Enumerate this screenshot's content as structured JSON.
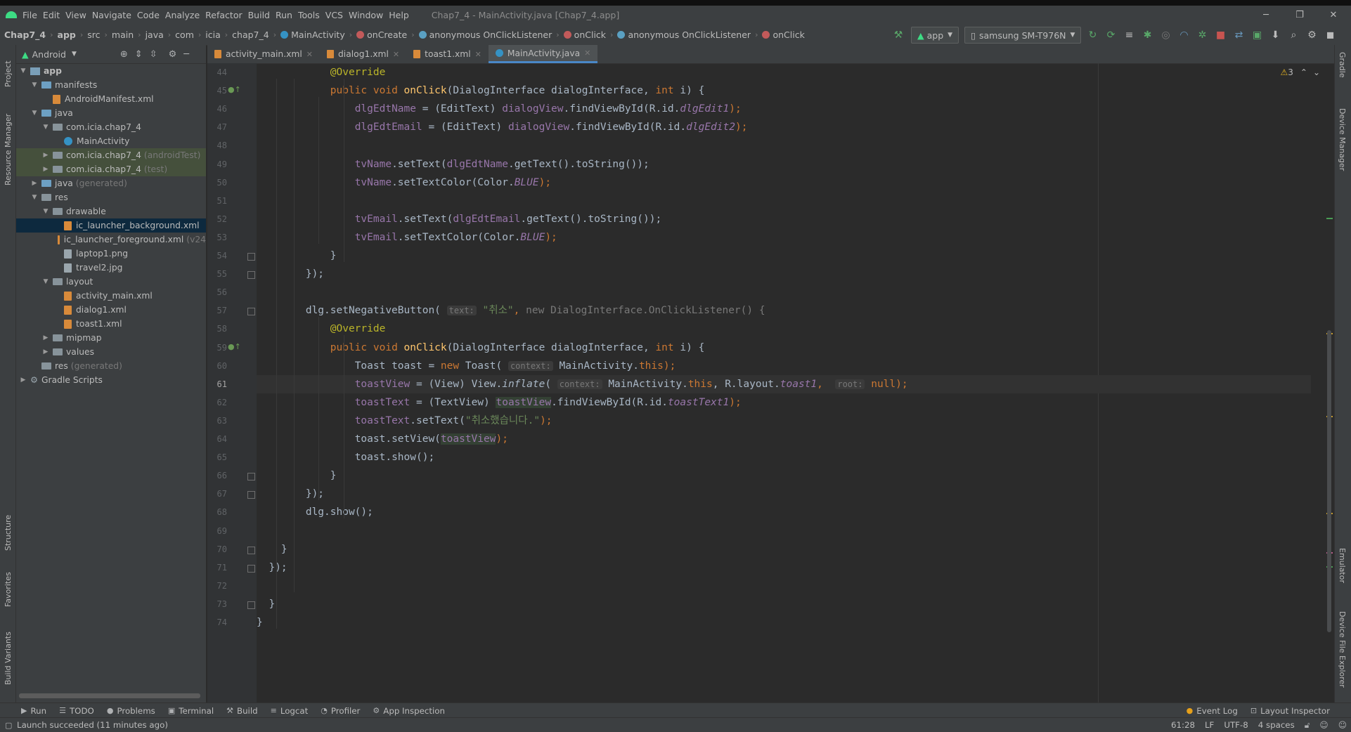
{
  "window": {
    "title": "Chap7_4 - MainActivity.java [Chap7_4.app]",
    "minimize": "─",
    "restore": "❐",
    "close": "✕"
  },
  "menu": [
    "File",
    "Edit",
    "View",
    "Navigate",
    "Code",
    "Analyze",
    "Refactor",
    "Build",
    "Run",
    "Tools",
    "VCS",
    "Window",
    "Help"
  ],
  "breadcrumb": [
    {
      "label": "Chap7_4",
      "icon": ""
    },
    {
      "label": "app",
      "icon": ""
    },
    {
      "label": "src",
      "icon": ""
    },
    {
      "label": "main",
      "icon": ""
    },
    {
      "label": "java",
      "icon": ""
    },
    {
      "label": "com",
      "icon": ""
    },
    {
      "label": "icia",
      "icon": ""
    },
    {
      "label": "chap7_4",
      "icon": ""
    },
    {
      "label": "MainActivity",
      "icon": "class-icon"
    },
    {
      "label": "onCreate",
      "icon": "method-icon"
    },
    {
      "label": "anonymous OnClickListener",
      "icon": "anonymous-class-icon"
    },
    {
      "label": "onClick",
      "icon": "method-icon"
    },
    {
      "label": "anonymous OnClickListener",
      "icon": "anonymous-class-icon"
    },
    {
      "label": "onClick",
      "icon": "method-icon"
    }
  ],
  "toolbar": {
    "run_config": "app",
    "device": "samsung SM-T976N"
  },
  "project_panel": {
    "view_selector": "Android",
    "tree": [
      {
        "label": "app",
        "suffix": "",
        "depth": 0,
        "arrow": "▼",
        "icon": "module",
        "bold": true
      },
      {
        "label": "manifests",
        "suffix": "",
        "depth": 1,
        "arrow": "▼",
        "icon": "folder-blue"
      },
      {
        "label": "AndroidManifest.xml",
        "suffix": "",
        "depth": 2,
        "arrow": "",
        "icon": "xml"
      },
      {
        "label": "java",
        "suffix": "",
        "depth": 1,
        "arrow": "▼",
        "icon": "folder-blue"
      },
      {
        "label": "com.icia.chap7_4",
        "suffix": "",
        "depth": 2,
        "arrow": "▼",
        "icon": "folder"
      },
      {
        "label": "MainActivity",
        "suffix": "",
        "depth": 3,
        "arrow": "",
        "icon": "class"
      },
      {
        "label": "com.icia.chap7_4",
        "suffix": "(androidTest)",
        "depth": 2,
        "arrow": "▶",
        "icon": "folder",
        "hl": true
      },
      {
        "label": "com.icia.chap7_4",
        "suffix": "(test)",
        "depth": 2,
        "arrow": "▶",
        "icon": "folder",
        "hl": true
      },
      {
        "label": "java",
        "suffix": "(generated)",
        "depth": 1,
        "arrow": "▶",
        "icon": "folder-blue"
      },
      {
        "label": "res",
        "suffix": "",
        "depth": 1,
        "arrow": "▼",
        "icon": "folder"
      },
      {
        "label": "drawable",
        "suffix": "",
        "depth": 2,
        "arrow": "▼",
        "icon": "folder"
      },
      {
        "label": "ic_launcher_background.xml",
        "suffix": "",
        "depth": 3,
        "arrow": "",
        "icon": "xml",
        "selected": true
      },
      {
        "label": "ic_launcher_foreground.xml",
        "suffix": "(v24",
        "depth": 3,
        "arrow": "",
        "icon": "xml"
      },
      {
        "label": "laptop1.png",
        "suffix": "",
        "depth": 3,
        "arrow": "",
        "icon": "img"
      },
      {
        "label": "travel2.jpg",
        "suffix": "",
        "depth": 3,
        "arrow": "",
        "icon": "img"
      },
      {
        "label": "layout",
        "suffix": "",
        "depth": 2,
        "arrow": "▼",
        "icon": "folder"
      },
      {
        "label": "activity_main.xml",
        "suffix": "",
        "depth": 3,
        "arrow": "",
        "icon": "xml"
      },
      {
        "label": "dialog1.xml",
        "suffix": "",
        "depth": 3,
        "arrow": "",
        "icon": "xml"
      },
      {
        "label": "toast1.xml",
        "suffix": "",
        "depth": 3,
        "arrow": "",
        "icon": "xml"
      },
      {
        "label": "mipmap",
        "suffix": "",
        "depth": 2,
        "arrow": "▶",
        "icon": "folder"
      },
      {
        "label": "values",
        "suffix": "",
        "depth": 2,
        "arrow": "▶",
        "icon": "folder"
      },
      {
        "label": "res",
        "suffix": "(generated)",
        "depth": 1,
        "arrow": "",
        "icon": "folder"
      },
      {
        "label": "Gradle Scripts",
        "suffix": "",
        "depth": 0,
        "arrow": "▶",
        "icon": "gradle"
      }
    ]
  },
  "editor_tabs": [
    {
      "label": "activity_main.xml",
      "active": false
    },
    {
      "label": "dialog1.xml",
      "active": false
    },
    {
      "label": "toast1.xml",
      "active": false
    },
    {
      "label": "MainActivity.java",
      "active": true
    }
  ],
  "inspection": {
    "warnings": "3"
  },
  "code_lines": [
    {
      "n": "44",
      "ind": "            ",
      "seg": [
        {
          "t": "@Override",
          "c": "an"
        }
      ]
    },
    {
      "n": "45",
      "ind": "            ",
      "mark": true,
      "seg": [
        {
          "t": "public void ",
          "c": "kw"
        },
        {
          "t": "onClick",
          "c": "fn"
        },
        {
          "t": "(DialogInterface dialogInterface, ",
          "c": ""
        },
        {
          "t": "int ",
          "c": "kw"
        },
        {
          "t": "i) {",
          "c": ""
        }
      ]
    },
    {
      "n": "46",
      "ind": "                ",
      "seg": [
        {
          "t": "dlgEdtName",
          "c": "fd"
        },
        {
          "t": " = (EditText) ",
          "c": ""
        },
        {
          "t": "dialogView",
          "c": "fd"
        },
        {
          "t": ".findViewById(R.id.",
          "c": ""
        },
        {
          "t": "dlgEdit1",
          "c": "fd it"
        },
        {
          "t": ");",
          "c": "kw"
        }
      ]
    },
    {
      "n": "47",
      "ind": "                ",
      "seg": [
        {
          "t": "dlgEdtEmail",
          "c": "fd"
        },
        {
          "t": " = (EditText) ",
          "c": ""
        },
        {
          "t": "dialogView",
          "c": "fd"
        },
        {
          "t": ".findViewById(R.id.",
          "c": ""
        },
        {
          "t": "dlgEdit2",
          "c": "fd it"
        },
        {
          "t": ");",
          "c": "kw"
        }
      ]
    },
    {
      "n": "48",
      "ind": "",
      "seg": []
    },
    {
      "n": "49",
      "ind": "                ",
      "seg": [
        {
          "t": "tvName",
          "c": "fd"
        },
        {
          "t": ".setText(",
          "c": ""
        },
        {
          "t": "dlgEdtName",
          "c": "fd"
        },
        {
          "t": ".getText().toString());",
          "c": ""
        }
      ]
    },
    {
      "n": "50",
      "ind": "                ",
      "seg": [
        {
          "t": "tvName",
          "c": "fd"
        },
        {
          "t": ".setTextColor(Color.",
          "c": ""
        },
        {
          "t": "BLUE",
          "c": "fd it"
        },
        {
          "t": ");",
          "c": "kw"
        }
      ]
    },
    {
      "n": "51",
      "ind": "",
      "seg": []
    },
    {
      "n": "52",
      "ind": "                ",
      "seg": [
        {
          "t": "tvEmail",
          "c": "fd"
        },
        {
          "t": ".setText(",
          "c": ""
        },
        {
          "t": "dlgEdtEmail",
          "c": "fd"
        },
        {
          "t": ".getText().toString());",
          "c": ""
        }
      ]
    },
    {
      "n": "53",
      "ind": "                ",
      "seg": [
        {
          "t": "tvEmail",
          "c": "fd"
        },
        {
          "t": ".setTextColor(Color.",
          "c": ""
        },
        {
          "t": "BLUE",
          "c": "fd it"
        },
        {
          "t": ");",
          "c": "kw"
        }
      ]
    },
    {
      "n": "54",
      "ind": "            ",
      "fold": true,
      "seg": [
        {
          "t": "}",
          "c": ""
        }
      ]
    },
    {
      "n": "55",
      "ind": "        ",
      "fold": true,
      "seg": [
        {
          "t": "});",
          "c": ""
        }
      ]
    },
    {
      "n": "56",
      "ind": "",
      "seg": []
    },
    {
      "n": "57",
      "ind": "        ",
      "fold": true,
      "seg": [
        {
          "t": "dlg.setNegativeButton( ",
          "c": ""
        },
        {
          "t": "text:",
          "c": "hint"
        },
        {
          "t": " \"취소\"",
          "c": "st"
        },
        {
          "t": ", ",
          "c": "kw"
        },
        {
          "t": "new DialogInterface.OnClickListener() {",
          "c": "gr"
        }
      ]
    },
    {
      "n": "58",
      "ind": "            ",
      "seg": [
        {
          "t": "@Override",
          "c": "an"
        }
      ]
    },
    {
      "n": "59",
      "ind": "            ",
      "mark": true,
      "seg": [
        {
          "t": "public void ",
          "c": "kw"
        },
        {
          "t": "onClick",
          "c": "fn"
        },
        {
          "t": "(DialogInterface dialogInterface, ",
          "c": ""
        },
        {
          "t": "int ",
          "c": "kw"
        },
        {
          "t": "i) {",
          "c": ""
        }
      ]
    },
    {
      "n": "60",
      "ind": "                ",
      "seg": [
        {
          "t": "Toast toast = ",
          "c": ""
        },
        {
          "t": "new ",
          "c": "kw"
        },
        {
          "t": "Toast( ",
          "c": ""
        },
        {
          "t": "context:",
          "c": "hint"
        },
        {
          "t": " MainActivity.",
          "c": ""
        },
        {
          "t": "this",
          "c": "kw"
        },
        {
          "t": ");",
          "c": "kw"
        }
      ]
    },
    {
      "n": "61",
      "ind": "                ",
      "cur": true,
      "seg": [
        {
          "t": "toastView",
          "c": "fd"
        },
        {
          "t": " = (View) View.",
          "c": ""
        },
        {
          "t": "inflate",
          "c": "it"
        },
        {
          "t": "( ",
          "c": ""
        },
        {
          "t": "context:",
          "c": "hint"
        },
        {
          "t": " MainActivity.",
          "c": ""
        },
        {
          "t": "this",
          "c": "kw"
        },
        {
          "t": ", R.layout.",
          "c": ""
        },
        {
          "t": "toast1",
          "c": "fd it"
        },
        {
          "t": ",  ",
          "c": "kw"
        },
        {
          "t": "root:",
          "c": "hint"
        },
        {
          "t": " null",
          "c": "kw"
        },
        {
          "t": ");",
          "c": "kw"
        }
      ]
    },
    {
      "n": "62",
      "ind": "                ",
      "seg": [
        {
          "t": "toastText",
          "c": "fd"
        },
        {
          "t": " = (TextView) ",
          "c": ""
        },
        {
          "t": "toastView",
          "c": "fd ref"
        },
        {
          "t": ".findViewById(R.id.",
          "c": ""
        },
        {
          "t": "toastText1",
          "c": "fd it"
        },
        {
          "t": ");",
          "c": "kw"
        }
      ]
    },
    {
      "n": "63",
      "ind": "                ",
      "seg": [
        {
          "t": "toastText",
          "c": "fd"
        },
        {
          "t": ".setText(",
          "c": ""
        },
        {
          "t": "\"취소했습니다.\"",
          "c": "st"
        },
        {
          "t": ");",
          "c": "kw"
        }
      ]
    },
    {
      "n": "64",
      "ind": "                ",
      "seg": [
        {
          "t": "toast.setView(",
          "c": ""
        },
        {
          "t": "toastView",
          "c": "fd ref"
        },
        {
          "t": ");",
          "c": "kw"
        }
      ]
    },
    {
      "n": "65",
      "ind": "                ",
      "seg": [
        {
          "t": "toast.show();",
          "c": ""
        }
      ]
    },
    {
      "n": "66",
      "ind": "            ",
      "fold": true,
      "seg": [
        {
          "t": "}",
          "c": ""
        }
      ]
    },
    {
      "n": "67",
      "ind": "        ",
      "fold": true,
      "seg": [
        {
          "t": "});",
          "c": ""
        }
      ]
    },
    {
      "n": "68",
      "ind": "        ",
      "seg": [
        {
          "t": "dlg.show();",
          "c": ""
        }
      ]
    },
    {
      "n": "69",
      "ind": "",
      "seg": []
    },
    {
      "n": "70",
      "ind": "    ",
      "fold": true,
      "seg": [
        {
          "t": "}",
          "c": ""
        }
      ]
    },
    {
      "n": "71",
      "ind": "  ",
      "fold": true,
      "seg": [
        {
          "t": "});",
          "c": ""
        }
      ]
    },
    {
      "n": "72",
      "ind": "",
      "seg": []
    },
    {
      "n": "73",
      "ind": "",
      "fold": true,
      "seg": [
        {
          "t": "  }",
          "c": ""
        }
      ]
    },
    {
      "n": "74",
      "ind": "",
      "seg": [
        {
          "t": "}",
          "c": ""
        }
      ]
    }
  ],
  "left_tabs": [
    "Project",
    "Resource Manager",
    "Structure",
    "Favorites",
    "Build Variants"
  ],
  "right_tabs": [
    "Gradle",
    "Device Manager",
    "Emulator",
    "Device File Explorer"
  ],
  "tool_windows": [
    {
      "label": "Run",
      "icon": "▶"
    },
    {
      "label": "TODO",
      "icon": "☰"
    },
    {
      "label": "Problems",
      "icon": "●"
    },
    {
      "label": "Terminal",
      "icon": "▣"
    },
    {
      "label": "Build",
      "icon": "⚒"
    },
    {
      "label": "Logcat",
      "icon": "≡"
    },
    {
      "label": "Profiler",
      "icon": "◔"
    },
    {
      "label": "App Inspection",
      "icon": "⚙"
    }
  ],
  "tool_windows_right": [
    {
      "label": "Event Log",
      "icon": "●"
    },
    {
      "label": "Layout Inspector",
      "icon": "⊡"
    }
  ],
  "status": {
    "message": "Launch succeeded (11 minutes ago)",
    "position": "61:28",
    "line_sep": "LF",
    "encoding": "UTF-8",
    "indent": "4 spaces"
  },
  "colors": {
    "keyword": "#cc7832",
    "annotation": "#bbb529",
    "method": "#ffc66d",
    "field": "#9876aa",
    "string": "#6a8759",
    "text": "#a9b7c6"
  }
}
